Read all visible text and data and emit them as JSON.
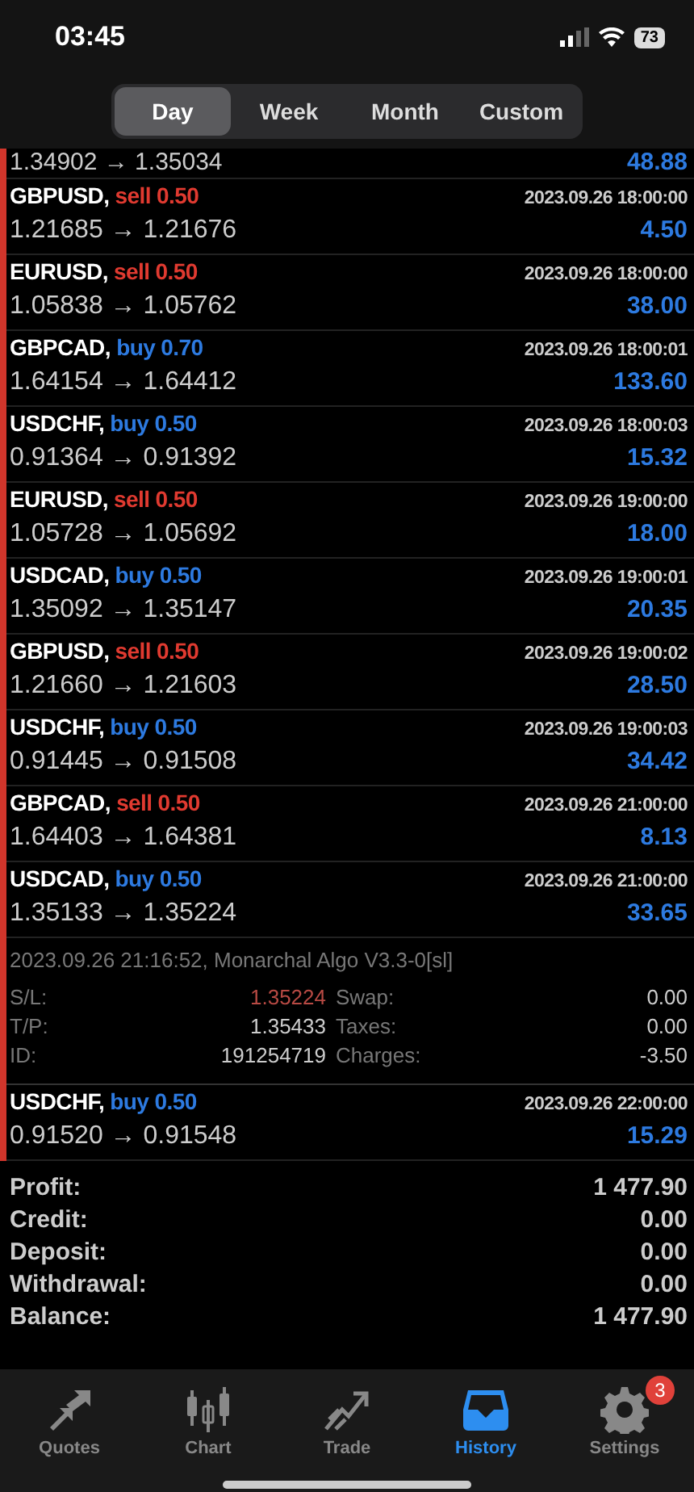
{
  "status_bar": {
    "time": "03:45",
    "battery": "73"
  },
  "tabs": [
    {
      "label": "Day",
      "selected": true
    },
    {
      "label": "Week",
      "selected": false
    },
    {
      "label": "Month",
      "selected": false
    },
    {
      "label": "Custom",
      "selected": false
    }
  ],
  "partial_row": {
    "prices": "1.34902 → 1.35034",
    "profit": "48.88"
  },
  "deals": [
    {
      "symbol": "GBPUSD,",
      "kind": "sell",
      "order": "sell 0.50",
      "time": "2023.09.26 18:00:00",
      "prices": "1.21685 → 1.21676",
      "profit": "4.50"
    },
    {
      "symbol": "EURUSD,",
      "kind": "sell",
      "order": "sell 0.50",
      "time": "2023.09.26 18:00:00",
      "prices": "1.05838 → 1.05762",
      "profit": "38.00"
    },
    {
      "symbol": "GBPCAD,",
      "kind": "buy",
      "order": "buy 0.70",
      "time": "2023.09.26 18:00:01",
      "prices": "1.64154 → 1.64412",
      "profit": "133.60"
    },
    {
      "symbol": "USDCHF,",
      "kind": "buy",
      "order": "buy 0.50",
      "time": "2023.09.26 18:00:03",
      "prices": "0.91364 → 0.91392",
      "profit": "15.32"
    },
    {
      "symbol": "EURUSD,",
      "kind": "sell",
      "order": "sell 0.50",
      "time": "2023.09.26 19:00:00",
      "prices": "1.05728 → 1.05692",
      "profit": "18.00"
    },
    {
      "symbol": "USDCAD,",
      "kind": "buy",
      "order": "buy 0.50",
      "time": "2023.09.26 19:00:01",
      "prices": "1.35092 → 1.35147",
      "profit": "20.35"
    },
    {
      "symbol": "GBPUSD,",
      "kind": "sell",
      "order": "sell 0.50",
      "time": "2023.09.26 19:00:02",
      "prices": "1.21660 → 1.21603",
      "profit": "28.50"
    },
    {
      "symbol": "USDCHF,",
      "kind": "buy",
      "order": "buy 0.50",
      "time": "2023.09.26 19:00:03",
      "prices": "0.91445 → 0.91508",
      "profit": "34.42"
    },
    {
      "symbol": "GBPCAD,",
      "kind": "sell",
      "order": "sell 0.50",
      "time": "2023.09.26 21:00:00",
      "prices": "1.64403 → 1.64381",
      "profit": "8.13"
    },
    {
      "symbol": "USDCAD,",
      "kind": "buy",
      "order": "buy 0.50",
      "time": "2023.09.26 21:00:00",
      "prices": "1.35133 → 1.35224",
      "profit": "33.65",
      "details": {
        "comment": "2023.09.26 21:16:52, Monarchal Algo V3.3-0[sl]",
        "sl_label": "S/L:",
        "sl": "1.35224",
        "tp_label": "T/P:",
        "tp": "1.35433",
        "id_label": "ID:",
        "id": "191254719",
        "swap_label": "Swap:",
        "swap": "0.00",
        "taxes_label": "Taxes:",
        "taxes": "0.00",
        "charges_label": "Charges:",
        "charges": "-3.50"
      }
    },
    {
      "symbol": "USDCHF,",
      "kind": "buy",
      "order": "buy 0.50",
      "time": "2023.09.26 22:00:00",
      "prices": "0.91520 → 0.91548",
      "profit": "15.29"
    }
  ],
  "summary": [
    {
      "label": "Profit:",
      "value": "1 477.90"
    },
    {
      "label": "Credit:",
      "value": "0.00"
    },
    {
      "label": "Deposit:",
      "value": "0.00"
    },
    {
      "label": "Withdrawal:",
      "value": "0.00"
    },
    {
      "label": "Balance:",
      "value": "1 477.90"
    }
  ],
  "tab_bar": [
    {
      "label": "Quotes",
      "kind": "quotes",
      "selected": false
    },
    {
      "label": "Chart",
      "kind": "chart",
      "selected": false
    },
    {
      "label": "Trade",
      "kind": "trade",
      "selected": false
    },
    {
      "label": "History",
      "kind": "history",
      "selected": true
    },
    {
      "label": "Settings",
      "kind": "settings",
      "selected": false,
      "badge": "3"
    }
  ]
}
